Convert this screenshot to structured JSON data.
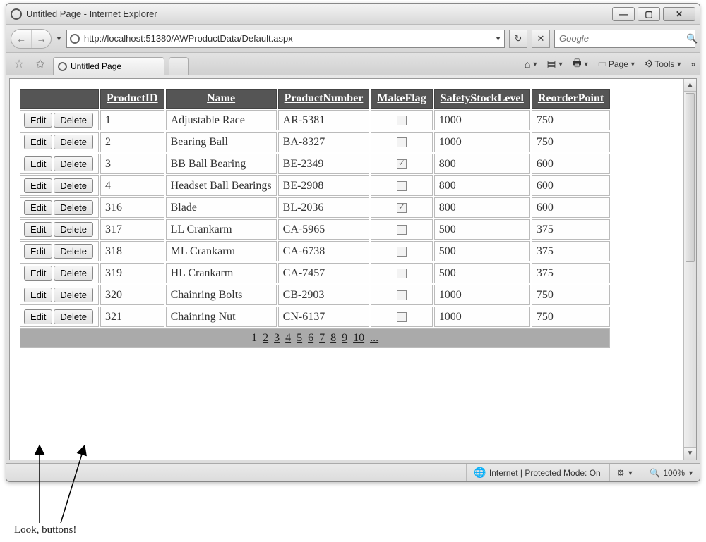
{
  "window": {
    "title": "Untitled Page - Internet Explorer",
    "url": "http://localhost:51380/AWProductData/Default.aspx",
    "search_placeholder": "Google",
    "tab_title": "Untitled Page"
  },
  "toolbar": {
    "page_label": "Page",
    "tools_label": "Tools"
  },
  "grid": {
    "columns": [
      "ProductID",
      "Name",
      "ProductNumber",
      "MakeFlag",
      "SafetyStockLevel",
      "ReorderPoint"
    ],
    "edit_label": "Edit",
    "delete_label": "Delete",
    "rows": [
      {
        "ProductID": "1",
        "Name": "Adjustable Race",
        "ProductNumber": "AR-5381",
        "MakeFlag": false,
        "SafetyStockLevel": "1000",
        "ReorderPoint": "750"
      },
      {
        "ProductID": "2",
        "Name": "Bearing Ball",
        "ProductNumber": "BA-8327",
        "MakeFlag": false,
        "SafetyStockLevel": "1000",
        "ReorderPoint": "750"
      },
      {
        "ProductID": "3",
        "Name": "BB Ball Bearing",
        "ProductNumber": "BE-2349",
        "MakeFlag": true,
        "SafetyStockLevel": "800",
        "ReorderPoint": "600"
      },
      {
        "ProductID": "4",
        "Name": "Headset Ball Bearings",
        "ProductNumber": "BE-2908",
        "MakeFlag": false,
        "SafetyStockLevel": "800",
        "ReorderPoint": "600"
      },
      {
        "ProductID": "316",
        "Name": "Blade",
        "ProductNumber": "BL-2036",
        "MakeFlag": true,
        "SafetyStockLevel": "800",
        "ReorderPoint": "600"
      },
      {
        "ProductID": "317",
        "Name": "LL Crankarm",
        "ProductNumber": "CA-5965",
        "MakeFlag": false,
        "SafetyStockLevel": "500",
        "ReorderPoint": "375"
      },
      {
        "ProductID": "318",
        "Name": "ML Crankarm",
        "ProductNumber": "CA-6738",
        "MakeFlag": false,
        "SafetyStockLevel": "500",
        "ReorderPoint": "375"
      },
      {
        "ProductID": "319",
        "Name": "HL Crankarm",
        "ProductNumber": "CA-7457",
        "MakeFlag": false,
        "SafetyStockLevel": "500",
        "ReorderPoint": "375"
      },
      {
        "ProductID": "320",
        "Name": "Chainring Bolts",
        "ProductNumber": "CB-2903",
        "MakeFlag": false,
        "SafetyStockLevel": "1000",
        "ReorderPoint": "750"
      },
      {
        "ProductID": "321",
        "Name": "Chainring Nut",
        "ProductNumber": "CN-6137",
        "MakeFlag": false,
        "SafetyStockLevel": "1000",
        "ReorderPoint": "750"
      }
    ],
    "pager": {
      "current": "1",
      "links": [
        "2",
        "3",
        "4",
        "5",
        "6",
        "7",
        "8",
        "9",
        "10",
        "..."
      ]
    }
  },
  "status": {
    "zone": "Internet | Protected Mode: On",
    "zoom": "100%"
  },
  "annotation": {
    "text": "Look, buttons!"
  }
}
